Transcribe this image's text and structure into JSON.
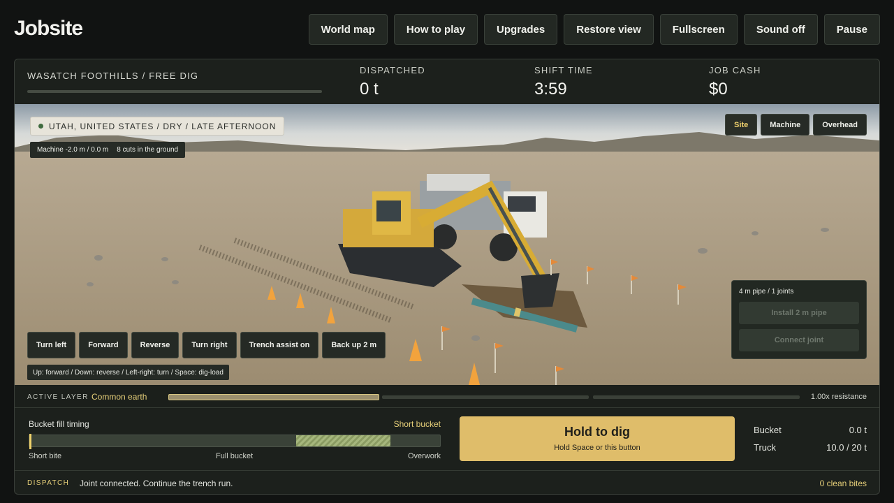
{
  "app": {
    "title": "Jobsite"
  },
  "nav": [
    "World map",
    "How to play",
    "Upgrades",
    "Restore view",
    "Fullscreen",
    "Sound off",
    "Pause"
  ],
  "stats": {
    "location": "WASATCH FOOTHILLS / FREE DIG",
    "dispatched_label": "DISPATCHED",
    "dispatched_value": "0 t",
    "shift_label": "SHIFT TIME",
    "shift_value": "3:59",
    "cash_label": "JOB CASH",
    "cash_value": "$0"
  },
  "viewport": {
    "location_pill": "UTAH, UNITED STATES / DRY / LATE AFTERNOON",
    "machine_pos": "Machine -2.0 m / 0.0 m",
    "cuts": "8 cuts in the ground",
    "views": [
      "Site",
      "Machine",
      "Overhead"
    ],
    "active_view": "Site",
    "controls": [
      "Turn left",
      "Forward",
      "Reverse",
      "Turn right",
      "Trench assist on",
      "Back up 2 m"
    ],
    "hint": "Up: forward / Down: reverse / Left-right: turn / Space: dig-load",
    "pipe": {
      "status": "4 m pipe / 1 joints",
      "install": "Install 2 m pipe",
      "connect": "Connect joint"
    }
  },
  "layer": {
    "label": "ACTIVE LAYER",
    "name": "Common earth",
    "resistance": "1.00x resistance",
    "active_segment": 1,
    "segment_count": 3
  },
  "timing": {
    "label": "Bucket fill timing",
    "state": "Short bucket",
    "marker_fraction": 0.0,
    "sweet_zone": [
      0.65,
      0.88
    ],
    "ticks": [
      "Short bite",
      "Full bucket",
      "Overwork"
    ]
  },
  "dig": {
    "title": "Hold to dig",
    "subtitle": "Hold Space or this button"
  },
  "loads": {
    "bucket_label": "Bucket",
    "bucket_value": "0.0 t",
    "truck_label": "Truck",
    "truck_value": "10.0 / 20 t"
  },
  "dispatch": {
    "label": "DISPATCH",
    "message": "Joint connected. Continue the trench run.",
    "clean_bites": "0 clean bites"
  },
  "colors": {
    "accent": "#e6cf79",
    "dig_button": "#dfbd6a",
    "panel": "#1c201c"
  }
}
